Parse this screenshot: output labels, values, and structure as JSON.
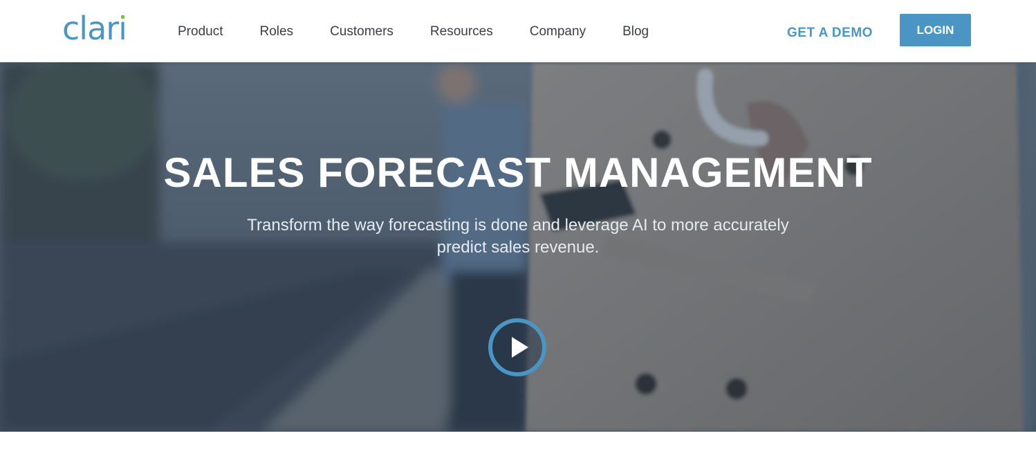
{
  "header": {
    "logo_text": "clari",
    "nav": [
      "Product",
      "Roles",
      "Customers",
      "Resources",
      "Company",
      "Blog"
    ],
    "demo_label": "GET A DEMO",
    "login_label": "LOGIN"
  },
  "hero": {
    "title": "SALES FORECAST MANAGEMENT",
    "subtitle": "Transform the way forecasting is done and leverage AI to more accurately predict sales revenue.",
    "play_icon": "play-icon"
  },
  "colors": {
    "brand_blue": "#4a95c4",
    "logo_dot_green": "#7cc04a",
    "nav_text": "#3a3f45"
  }
}
